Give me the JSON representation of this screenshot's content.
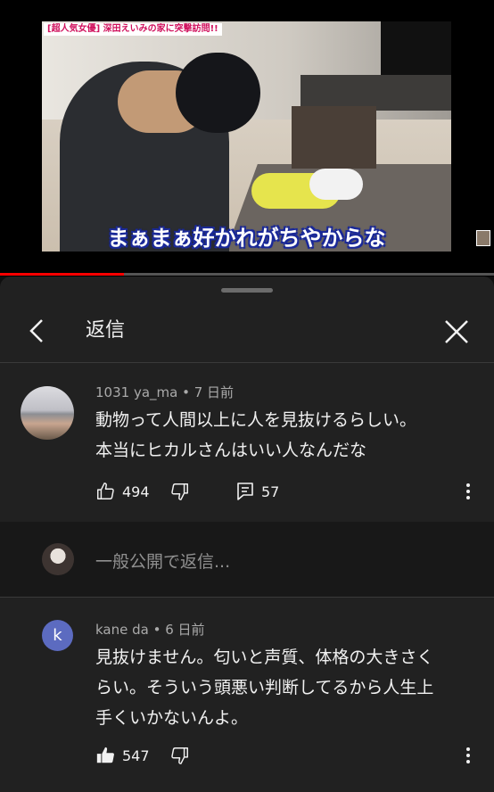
{
  "video": {
    "badge": "[超人気女優] 深田えいみの家に突撃訪問!!",
    "caption": "まぁまぁ好かれがちやからな",
    "progress_fraction": 0.25
  },
  "sheet": {
    "title": "返信"
  },
  "comment": {
    "author": "1031 ya_ma",
    "time": "7 日前",
    "text_line1": "動物って人間以上に人を見抜けるらしい。",
    "text_line2": "本当にヒカルさんはいい人なんだな",
    "likes": "494",
    "replies": "57"
  },
  "reply_input": {
    "placeholder": "一般公開で返信..."
  },
  "reply": {
    "avatar_letter": "k",
    "author": "kane da",
    "time": "6 日前",
    "text_line1": "見抜けません。匂いと声質、体格の大きさく",
    "text_line2": "らい。そういう頭悪い判断してるから人生上",
    "text_line3": "手くいかないんよ。",
    "likes": "547"
  },
  "colors": {
    "background": "#0f0f0f",
    "sheet": "#212121",
    "progress": "#ff0000",
    "avatar_k": "#5c6bc0"
  },
  "icons": [
    "back-arrow-icon",
    "close-icon",
    "thumb-up-icon",
    "thumb-down-icon",
    "reply-icon",
    "more-vert-icon"
  ]
}
